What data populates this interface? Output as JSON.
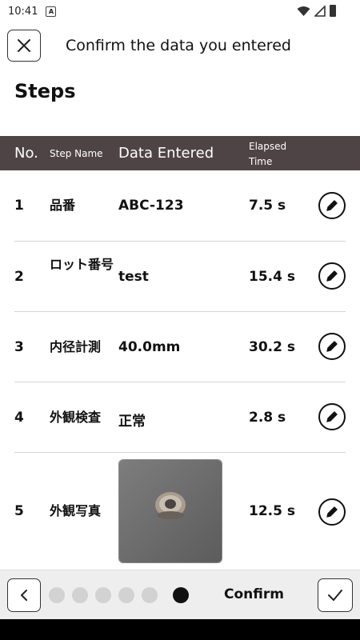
{
  "status_bar": {
    "time": "10:41",
    "notif_letter": "A",
    "icons": [
      "wifi-icon",
      "signal-icon",
      "battery-icon"
    ]
  },
  "header": {
    "title": "Confirm the data you entered",
    "close_icon": "close-icon"
  },
  "section_title": "Steps",
  "table": {
    "columns": {
      "no": "No.",
      "step_name": "Step Name",
      "data_entered": "Data Entered",
      "elapsed_time": "Elapsed Time"
    },
    "rows": [
      {
        "no": "1",
        "step_name": "品番",
        "data": "ABC-123",
        "elapsed": "7.5 s"
      },
      {
        "no": "2",
        "step_name": "ロット番号",
        "data": "test",
        "elapsed": "15.4 s"
      },
      {
        "no": "3",
        "step_name": "内径計測",
        "data": "40.0mm",
        "elapsed": "30.2 s"
      },
      {
        "no": "4",
        "step_name": "外観検査",
        "data": "正常",
        "elapsed": "2.8 s"
      },
      {
        "no": "5",
        "step_name": "外観写真",
        "data": "",
        "elapsed": "12.5 s"
      }
    ]
  },
  "bottom_bar": {
    "confirm_label": "Confirm",
    "progress": {
      "current_step": 6,
      "total_steps": 6
    }
  },
  "colors": {
    "table_header_bg": "#4f4445",
    "bottom_bar_bg": "#eeeeee",
    "active_dot": "#111111",
    "inactive_dot": "#d2d2d2"
  }
}
